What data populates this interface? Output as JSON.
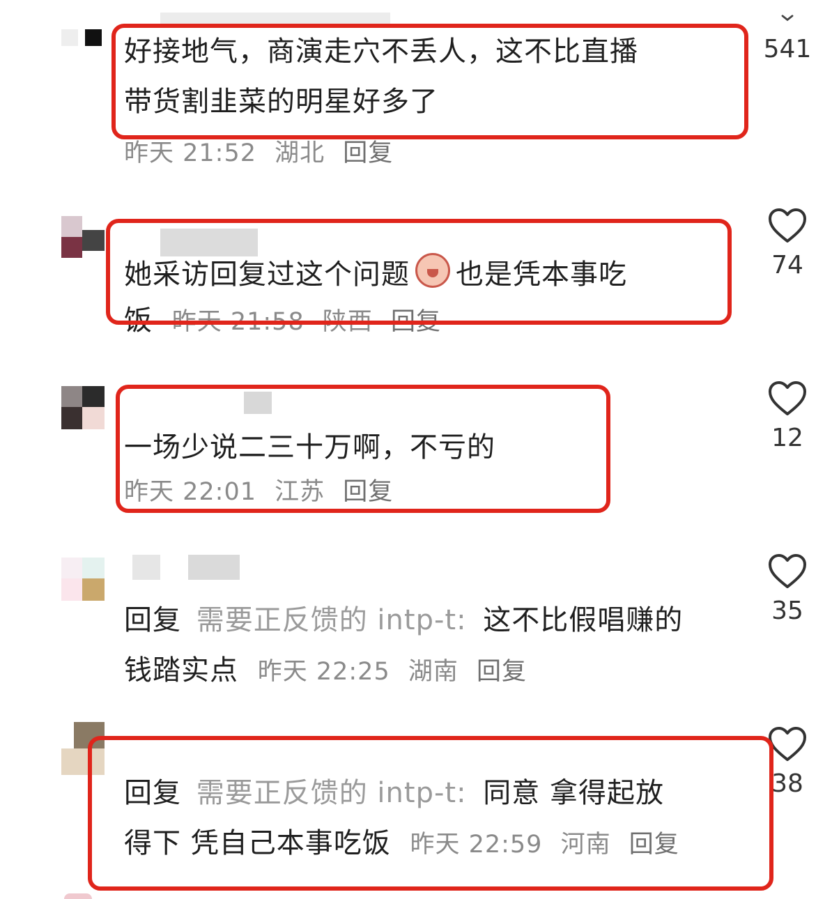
{
  "colors": {
    "highlight": "#e0251b",
    "meta": "#8a8a8a",
    "text": "#1f1f1f"
  },
  "comments": [
    {
      "text": "好接地气，商演走穴不丢人，这不比直播带货割韭菜的明星好多了",
      "line1": "好接地气，商演走穴不丢人，这不比直播",
      "line2": "带货割韭菜的明星好多了",
      "time": "昨天 21:52",
      "location": "湖北",
      "reply_label": "回复",
      "likes": "541"
    },
    {
      "text_before_emoji": "她采访回复过这个问题",
      "text_after_emoji": "也是凭本事吃",
      "line2": "饭",
      "emoji": "emoji-icon",
      "time": "昨天 21:58",
      "location": "陕西",
      "reply_label": "回复",
      "likes": "74"
    },
    {
      "text": "一场少说二三十万啊，不亏的",
      "time": "昨天 22:01",
      "location": "江苏",
      "reply_label": "回复",
      "likes": "12"
    },
    {
      "reply_prefix": "回复",
      "reply_target": "需要正反馈的 intp-t:",
      "text_line1": "这不比假唱赚的",
      "text_line2": "钱踏实点",
      "time": "昨天 22:25",
      "location": "湖南",
      "reply_label": "回复",
      "likes": "35"
    },
    {
      "reply_prefix": "回复",
      "reply_target": "需要正反馈的 intp-t:",
      "text_line1": "同意 拿得起放",
      "text_line2": "得下 凭自己本事吃饭",
      "time": "昨天 22:59",
      "location": "河南",
      "reply_label": "回复",
      "likes": "38"
    }
  ]
}
